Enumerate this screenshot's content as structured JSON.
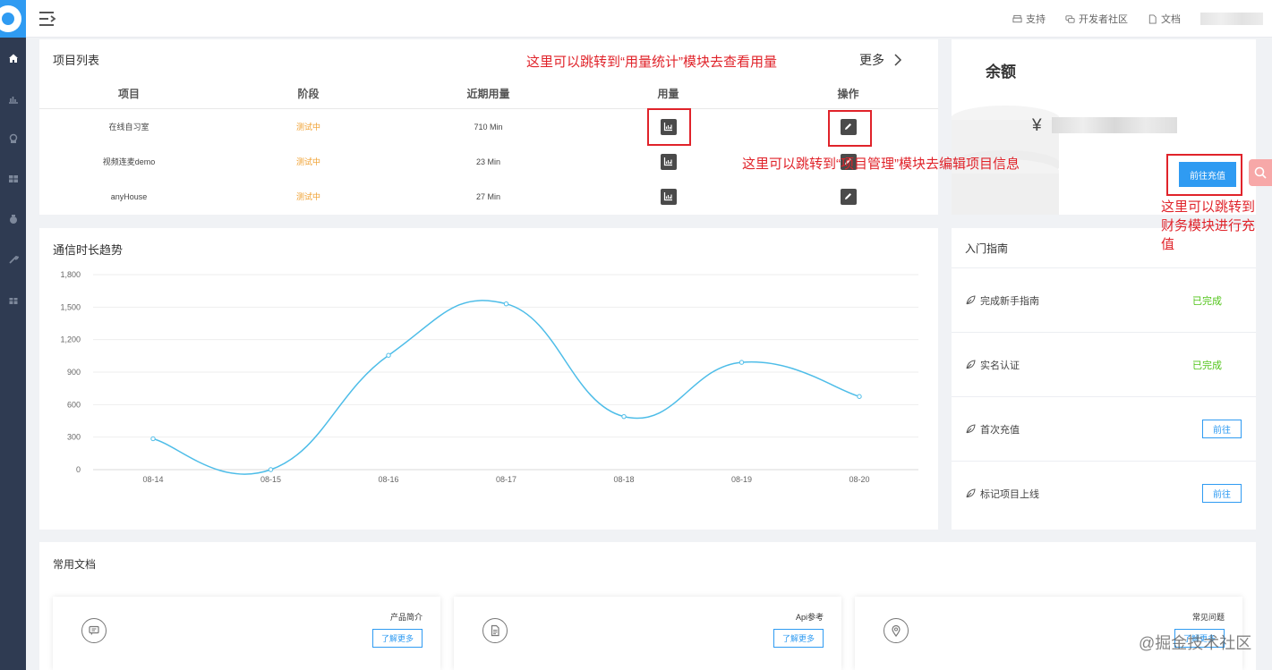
{
  "header": {
    "links": [
      {
        "label": "支持",
        "icon": "printer-icon"
      },
      {
        "label": "开发者社区",
        "icon": "chat-icon"
      },
      {
        "label": "文档",
        "icon": "document-icon"
      }
    ]
  },
  "sidebar": {
    "items": [
      "home-icon",
      "bar-chart-icon",
      "broadcast-icon",
      "grid-icon",
      "wallet-icon",
      "wrench-icon",
      "gift-icon"
    ]
  },
  "projects": {
    "title": "项目列表",
    "more": "更多",
    "columns": [
      "项目",
      "阶段",
      "近期用量",
      "用量",
      "操作"
    ],
    "rows": [
      {
        "name": "在线自习室",
        "stage": "测试中",
        "usage": "710 Min"
      },
      {
        "name": "视频连麦demo",
        "stage": "测试中",
        "usage": "23 Min"
      },
      {
        "name": "anyHouse",
        "stage": "测试中",
        "usage": "27 Min"
      }
    ]
  },
  "balance": {
    "title": "余额",
    "currency": "¥",
    "recharge_button": "前往充值"
  },
  "trend": {
    "title": "通信时长趋势"
  },
  "chart_data": {
    "type": "line",
    "x": [
      "08-14",
      "08-15",
      "08-16",
      "08-17",
      "08-18",
      "08-19",
      "08-20"
    ],
    "values": [
      285,
      0,
      1055,
      1530,
      490,
      990,
      675
    ],
    "yticks": [
      0,
      300,
      600,
      900,
      1200,
      1500,
      1800
    ],
    "ytick_labels": [
      "0",
      "300",
      "600",
      "900",
      "1,200",
      "1,500",
      "1,800"
    ],
    "ylim": [
      0,
      1800
    ],
    "color": "#4ebde8",
    "grid": true
  },
  "guide": {
    "title": "入门指南",
    "items": [
      {
        "label": "完成新手指南",
        "status": "已完成",
        "done": true
      },
      {
        "label": "实名认证",
        "status": "已完成",
        "done": true
      },
      {
        "label": "首次充值",
        "status": "前往",
        "done": false
      },
      {
        "label": "标记项目上线",
        "status": "前往",
        "done": false
      }
    ]
  },
  "docs": {
    "title": "常用文档",
    "cards": [
      {
        "name": "产品简介",
        "button": "了解更多",
        "icon": "message-icon"
      },
      {
        "name": "Api参考",
        "button": "了解更多",
        "icon": "file-icon"
      },
      {
        "name": "常见问题",
        "button": "了解更多",
        "icon": "location-icon"
      }
    ]
  },
  "annotations": {
    "usage": "这里可以跳转到“用量统计”模块去查看用量",
    "edit": "这里可以跳转到“项目管理”模块去编辑项目信息",
    "recharge_line1": "这里可以跳转到",
    "recharge_line2": "财务模块进行充",
    "recharge_line3": "值"
  },
  "watermark": "@掘金技术社区"
}
